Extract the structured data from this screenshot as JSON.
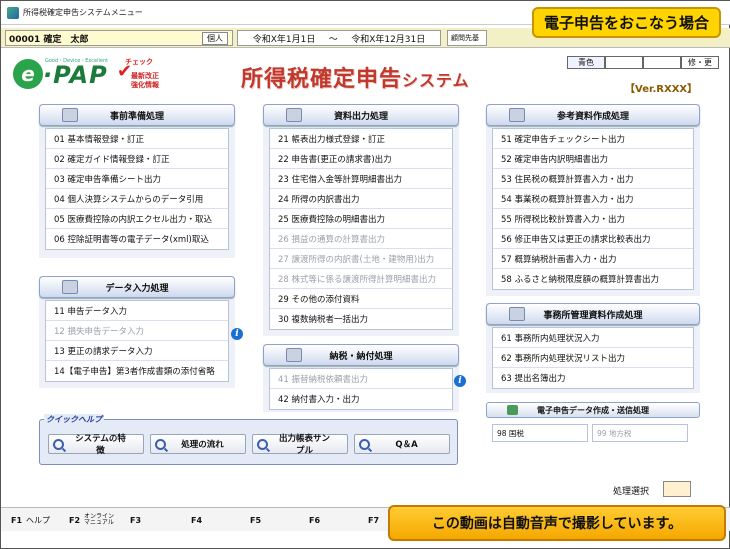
{
  "window": {
    "title": "所得税確定申告システムメニュー"
  },
  "overlays": {
    "top_banner": "電子申告をおこなう場合",
    "bottom_banner": "この動画は自動音声で撮影しています。"
  },
  "info_bar": {
    "user": "00001 確定　太郎",
    "user_kind": "個人",
    "period_start": "令和X年1月1日",
    "period_sep": "～",
    "period_end": "令和X年12月31日",
    "comm": "顧問先基"
  },
  "header": {
    "logo_text": "e-PAP",
    "logo_sub": "Good・Device・Excellent",
    "badge_check": "チェック",
    "badge_line1": "最新改正",
    "badge_line2": "強化情報",
    "title_main": "所得税確定申告",
    "title_suffix": "システム",
    "color_label": "青色",
    "fix_label": "修・更",
    "version": "【Ver.RXXX】"
  },
  "panels": {
    "prep": {
      "title": "事前準備処理",
      "items": [
        "01 基本情報登録・訂正",
        "02 確定ガイド情報登録・訂正",
        "03 確定申告準備シート出力",
        "04 個人決算システムからのデータ引用",
        "05 医療費控除の内訳エクセル出力・取込",
        "06 控除証明書等の電子データ(xml)取込"
      ]
    },
    "data_input": {
      "title": "データ入力処理",
      "items": [
        "11 申告データ入力",
        "12 損失申告データ入力",
        "13 更正の請求データ入力",
        "14【電子申告】第3者作成書類の添付省略"
      ]
    },
    "output": {
      "title": "資料出力処理",
      "items": [
        "21 帳表出力様式登録・訂正",
        "22 申告書(更正の請求書)出力",
        "23 住宅借入金等計算明細書出力",
        "24 所得の内訳書出力",
        "25 医療費控除の明細書出力",
        "26 損益の通算の計算書出力",
        "27 譲渡所得の内訳書(土地・建物用)出力",
        "28 株式等に係る譲渡所得計算明細書出力",
        "29 その他の添付資料",
        "30 複数納税者一括出力"
      ]
    },
    "tax_payment": {
      "title": "納税・納付処理",
      "items": [
        "41 振替納税依頼書出力",
        "42 納付書入力・出力"
      ]
    },
    "reference": {
      "title": "参考資料作成処理",
      "items": [
        "51 確定申告チェックシート出力",
        "52 確定申告内訳明細書出力",
        "53 住民税の概算計算書入力・出力",
        "54 事業税の概算計算書入力・出力",
        "55 所得税比較計算書入力・出力",
        "56 修正申告又は更正の請求比較表出力",
        "57 概算納税計画書入力・出力",
        "58 ふるさと納税限度額の概算計算書出力"
      ]
    },
    "office": {
      "title": "事務所管理資料作成処理",
      "items": [
        "61 事務所内処理状況入力",
        "62 事務所内処理状況リスト出力",
        "63 提出名簿出力"
      ]
    },
    "transmit": {
      "title": "電子申告データ作成・送信処理",
      "national": "98 国税",
      "local": "99 地方税"
    }
  },
  "quick_help": {
    "label": "クイックヘルプ",
    "buttons": [
      "システムの特徴",
      "処理の流れ",
      "出力帳表サンプル",
      "Q＆A"
    ]
  },
  "process_select": {
    "label": "処理選択"
  },
  "fkeys": [
    {
      "key": "F1",
      "label": "ヘルプ"
    },
    {
      "key": "F2",
      "label_top": "オンライン",
      "label_bottom": "マニュアル"
    },
    {
      "key": "F3",
      "label": ""
    },
    {
      "key": "F4",
      "label": ""
    },
    {
      "key": "F5",
      "label": ""
    },
    {
      "key": "F6",
      "label": ""
    },
    {
      "key": "F7",
      "label": ""
    }
  ]
}
